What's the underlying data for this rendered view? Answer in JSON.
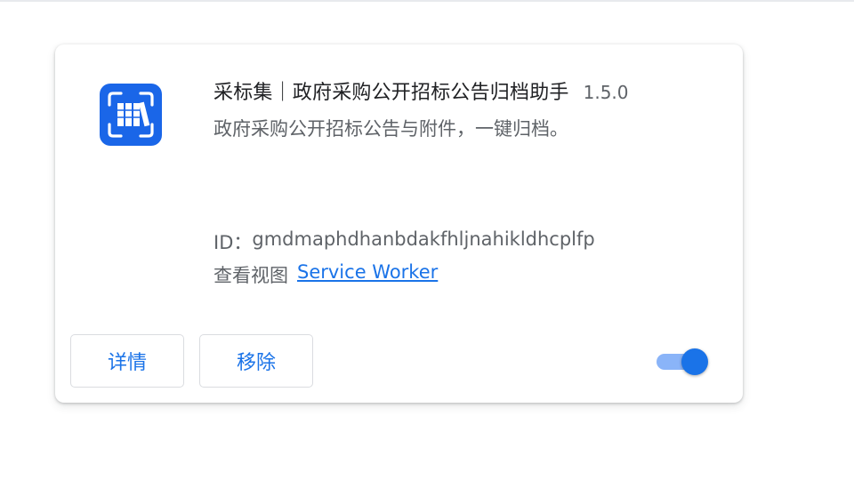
{
  "extension": {
    "name": "采标集｜政府采购公开招标公告归档助手",
    "version": "1.5.0",
    "description": "政府采购公开招标公告与附件，一键归档。",
    "id_label": "ID：",
    "id_value": "gmdmaphdhanbdakfhljnahikldhcplfp",
    "views_label": "查看视图",
    "views_link": "Service Worker",
    "icon": "archive-box-icon",
    "enabled": true
  },
  "buttons": {
    "details_label": "详情",
    "remove_label": "移除"
  },
  "colors": {
    "accent": "#1a73e8",
    "toggle_track": "#8ab4f8",
    "icon_bg": "#1a66e8"
  }
}
